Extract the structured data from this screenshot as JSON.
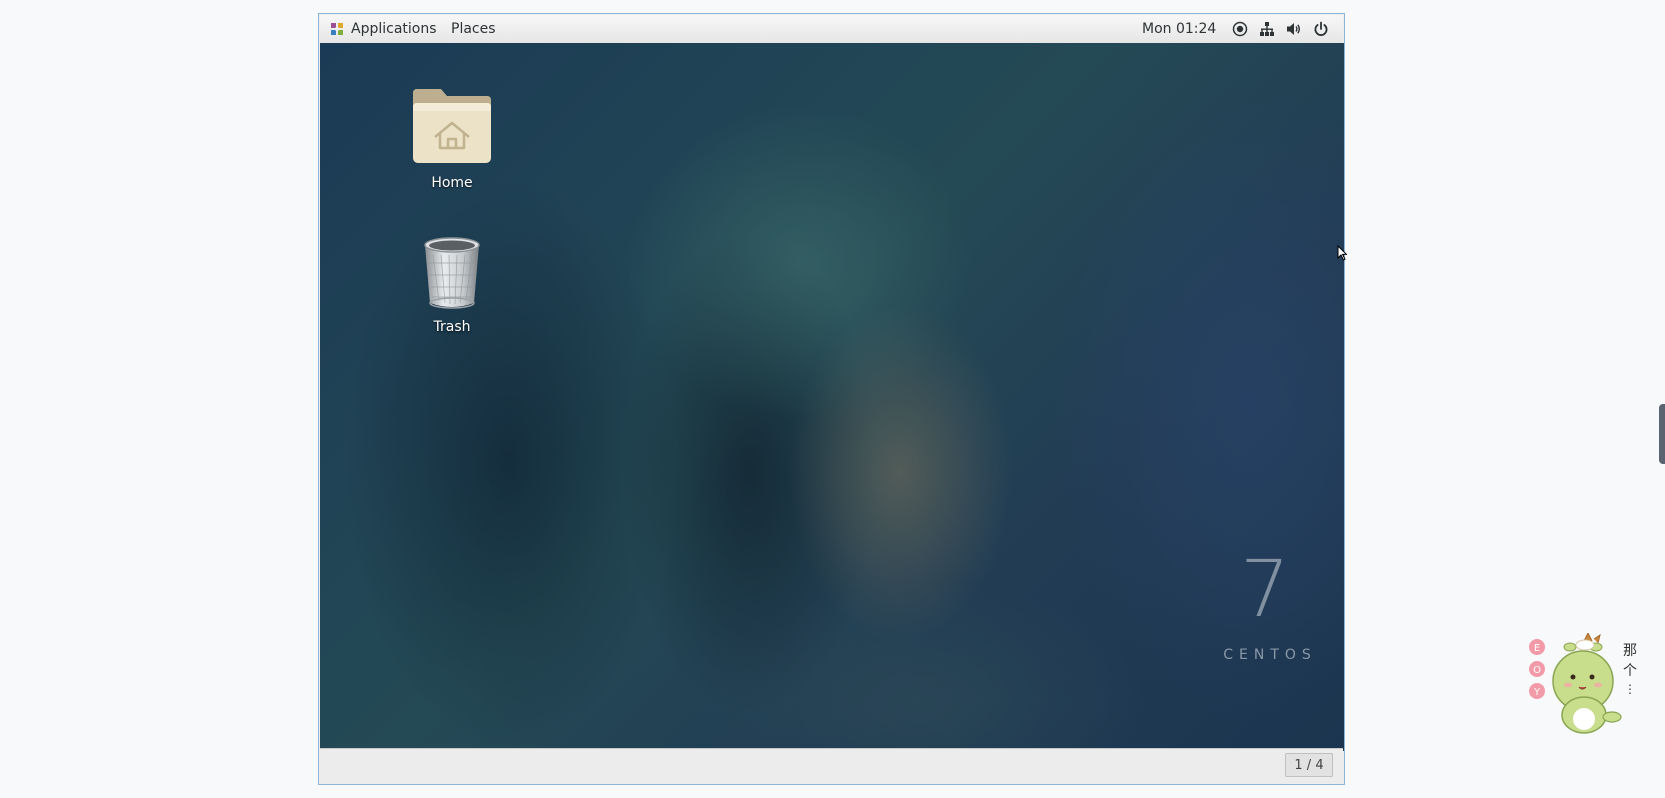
{
  "topbar": {
    "applications_label": "Applications",
    "places_label": "Places",
    "clock": "Mon 01:24",
    "tray_icons": [
      "accessibility-icon",
      "network-icon",
      "volume-icon",
      "power-icon"
    ]
  },
  "desktop": {
    "icons": [
      {
        "label": "Home",
        "icon": "home-folder-icon"
      },
      {
        "label": "Trash",
        "icon": "trash-icon"
      }
    ],
    "watermark": {
      "number": "7",
      "word": "CENTOS"
    }
  },
  "bottombar": {
    "workspace": "1 / 4"
  },
  "overlay": {
    "mascot_text": [
      "那",
      "个",
      "⋮"
    ],
    "mascot_badges": [
      "E",
      "O",
      "Y"
    ]
  },
  "colors": {
    "page_background": "#f8f9fa",
    "frame_border": "#8fb6d9",
    "panel": "#ededed"
  }
}
